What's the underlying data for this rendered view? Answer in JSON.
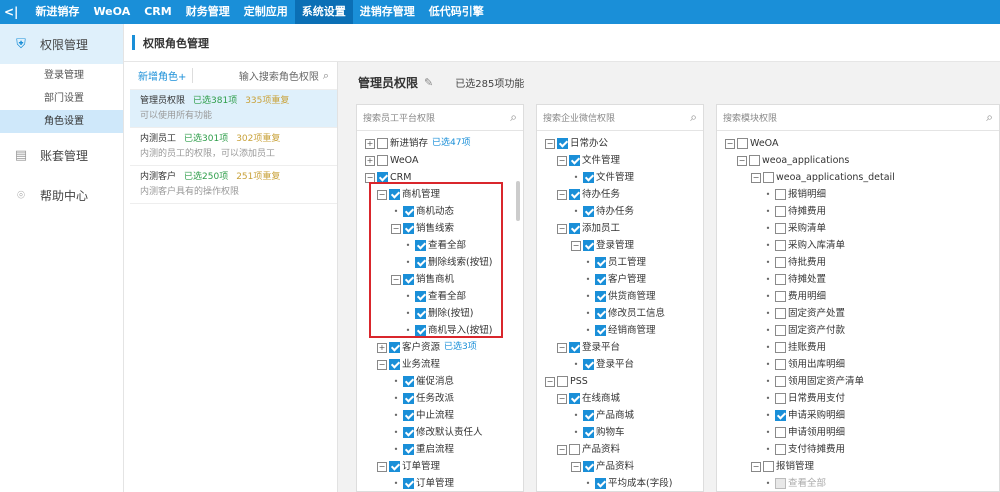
{
  "topbar": {
    "back": "<|",
    "items": [
      "新进销存",
      "WeOA",
      "CRM",
      "财务管理",
      "定制应用",
      "系统设置",
      "进销存管理",
      "低代码引擎"
    ],
    "active_index": 5
  },
  "sidebar": {
    "perm": {
      "label": "权限管理",
      "icon": "shield-icon"
    },
    "subs": [
      "登录管理",
      "部门设置",
      "角色设置"
    ],
    "active_sub": 2,
    "account": {
      "label": "账套管理",
      "icon": "ledger-icon"
    },
    "help": {
      "label": "帮助中心",
      "icon": "help-icon"
    }
  },
  "header": {
    "title": "权限角色管理"
  },
  "roles": {
    "add_label": "新增角色+",
    "search_placeholder": "输入搜索角色权限",
    "items": [
      {
        "name": "管理员权限",
        "selected": "已选381项",
        "modified": "335项重复",
        "desc": "可以使用所有功能"
      },
      {
        "name": "内测员工",
        "selected": "已选301项",
        "modified": "302项重复",
        "desc": "内测的员工的权限，可以添加员工"
      },
      {
        "name": "内测客户",
        "selected": "已选250项",
        "modified": "251项重复",
        "desc": "内测客户具有的操作权限"
      }
    ]
  },
  "content": {
    "title": "管理员权限",
    "count": "已选285项功能"
  },
  "columns": [
    {
      "search": "搜索员工平台权限",
      "nodes": [
        {
          "l": 0,
          "t": "+",
          "c": 0,
          "text": "新进销存",
          "badge": "已选47项"
        },
        {
          "l": 0,
          "t": "+",
          "c": 0,
          "text": "WeOA"
        },
        {
          "l": 0,
          "t": "-",
          "c": 1,
          "text": "CRM"
        },
        {
          "l": 1,
          "t": "-",
          "c": 1,
          "text": "商机管理"
        },
        {
          "l": 2,
          "t": ".",
          "c": 1,
          "text": "商机动态"
        },
        {
          "l": 2,
          "t": "-",
          "c": 1,
          "text": "销售线索"
        },
        {
          "l": 3,
          "t": ".",
          "c": 1,
          "text": "查看全部"
        },
        {
          "l": 3,
          "t": ".",
          "c": 1,
          "text": "删除线索(按钮)"
        },
        {
          "l": 2,
          "t": "-",
          "c": 1,
          "text": "销售商机"
        },
        {
          "l": 3,
          "t": ".",
          "c": 1,
          "text": "查看全部"
        },
        {
          "l": 3,
          "t": ".",
          "c": 1,
          "text": "删除(按钮)"
        },
        {
          "l": 3,
          "t": ".",
          "c": 1,
          "text": "商机导入(按钮)"
        },
        {
          "l": 1,
          "t": "+",
          "c": 1,
          "text": "客户资源",
          "badge": "已选3项"
        },
        {
          "l": 1,
          "t": "-",
          "c": 1,
          "text": "业务流程"
        },
        {
          "l": 2,
          "t": ".",
          "c": 1,
          "text": "催促消息"
        },
        {
          "l": 2,
          "t": ".",
          "c": 1,
          "text": "任务改派"
        },
        {
          "l": 2,
          "t": ".",
          "c": 1,
          "text": "中止流程"
        },
        {
          "l": 2,
          "t": ".",
          "c": 1,
          "text": "修改默认责任人"
        },
        {
          "l": 2,
          "t": ".",
          "c": 1,
          "text": "重启流程"
        },
        {
          "l": 1,
          "t": "-",
          "c": 1,
          "text": "订单管理"
        },
        {
          "l": 2,
          "t": ".",
          "c": 1,
          "text": "订单管理"
        }
      ]
    },
    {
      "search": "搜索企业微信权限",
      "nodes": [
        {
          "l": 0,
          "t": "-",
          "c": 1,
          "text": "日常办公"
        },
        {
          "l": 1,
          "t": "-",
          "c": 1,
          "text": "文件管理"
        },
        {
          "l": 2,
          "t": ".",
          "c": 1,
          "text": "文件管理"
        },
        {
          "l": 1,
          "t": "-",
          "c": 1,
          "text": "待办任务"
        },
        {
          "l": 2,
          "t": ".",
          "c": 1,
          "text": "待办任务"
        },
        {
          "l": 1,
          "t": "-",
          "c": 1,
          "text": "添加员工"
        },
        {
          "l": 2,
          "t": "-",
          "c": 1,
          "text": "登录管理"
        },
        {
          "l": 3,
          "t": ".",
          "c": 1,
          "text": "员工管理"
        },
        {
          "l": 3,
          "t": ".",
          "c": 1,
          "text": "客户管理"
        },
        {
          "l": 3,
          "t": ".",
          "c": 1,
          "text": "供货商管理"
        },
        {
          "l": 3,
          "t": ".",
          "c": 1,
          "text": "修改员工信息"
        },
        {
          "l": 3,
          "t": ".",
          "c": 1,
          "text": "经销商管理"
        },
        {
          "l": 1,
          "t": "-",
          "c": 1,
          "text": "登录平台"
        },
        {
          "l": 2,
          "t": ".",
          "c": 1,
          "text": "登录平台"
        },
        {
          "l": 0,
          "t": "-",
          "c": 0,
          "text": "PSS"
        },
        {
          "l": 1,
          "t": "-",
          "c": 1,
          "text": "在线商城"
        },
        {
          "l": 2,
          "t": ".",
          "c": 1,
          "text": "产品商城"
        },
        {
          "l": 2,
          "t": ".",
          "c": 1,
          "text": "购物车"
        },
        {
          "l": 1,
          "t": "-",
          "c": 0,
          "text": "产品资料"
        },
        {
          "l": 2,
          "t": "-",
          "c": 1,
          "text": "产品资料"
        },
        {
          "l": 3,
          "t": ".",
          "c": 1,
          "text": "平均成本(字段)"
        }
      ]
    },
    {
      "search": "搜索模块权限",
      "nodes": [
        {
          "l": 0,
          "t": "-",
          "c": 0,
          "text": "WeOA"
        },
        {
          "l": 1,
          "t": "-",
          "c": 0,
          "text": "weoa_applications"
        },
        {
          "l": 2,
          "t": "-",
          "c": 0,
          "text": "weoa_applications_detail"
        },
        {
          "l": 3,
          "t": ".",
          "c": 0,
          "text": "报销明细"
        },
        {
          "l": 3,
          "t": ".",
          "c": 0,
          "text": "待摊费用"
        },
        {
          "l": 3,
          "t": ".",
          "c": 0,
          "text": "采购清单"
        },
        {
          "l": 3,
          "t": ".",
          "c": 0,
          "text": "采购入库清单"
        },
        {
          "l": 3,
          "t": ".",
          "c": 0,
          "text": "待批费用"
        },
        {
          "l": 3,
          "t": ".",
          "c": 0,
          "text": "待摊处置"
        },
        {
          "l": 3,
          "t": ".",
          "c": 0,
          "text": "费用明细"
        },
        {
          "l": 3,
          "t": ".",
          "c": 0,
          "text": "固定资产处置"
        },
        {
          "l": 3,
          "t": ".",
          "c": 0,
          "text": "固定资产付款"
        },
        {
          "l": 3,
          "t": ".",
          "c": 0,
          "text": "挂账费用"
        },
        {
          "l": 3,
          "t": ".",
          "c": 0,
          "text": "领用出库明细"
        },
        {
          "l": 3,
          "t": ".",
          "c": 0,
          "text": "领用固定资产清单"
        },
        {
          "l": 3,
          "t": ".",
          "c": 0,
          "text": "日常费用支付"
        },
        {
          "l": 3,
          "t": ".",
          "c": 1,
          "text": "申请采购明细"
        },
        {
          "l": 3,
          "t": ".",
          "c": 0,
          "text": "申请领用明细"
        },
        {
          "l": 3,
          "t": ".",
          "c": 0,
          "text": "支付待摊费用"
        },
        {
          "l": 2,
          "t": "-",
          "c": 0,
          "text": "报销管理"
        },
        {
          "l": 3,
          "t": ".",
          "c": 2,
          "text": "查看全部"
        }
      ]
    }
  ]
}
